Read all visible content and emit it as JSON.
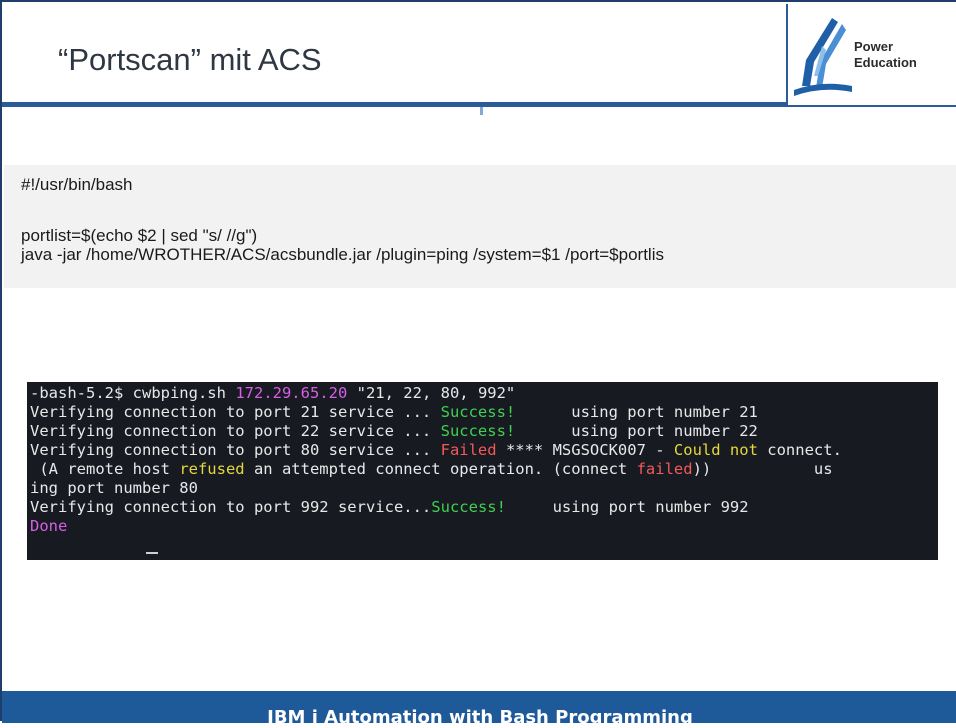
{
  "slide": {
    "title": "“Portscan” mit ACS",
    "logo": {
      "line1": "Power",
      "line2": "Education",
      "icon": "power-education-logo-icon"
    },
    "script": {
      "shebang": "#!/usr/bin/bash",
      "line_portlist": "portlist=$(echo $2 | sed \"s/ //g\")",
      "line_java": "java -jar /home/WROTHER/ACS/acsbundle.jar /plugin=ping /system=$1 /port=$portlis"
    },
    "terminal": {
      "prompt": "-bash-5.2$ cwbping.sh ",
      "ip": "172.29.65.20",
      "args": " \"21, 22, 80, 992\"",
      "l1_prefix": "Verifying connection to port 21 service ... ",
      "l1_status": "Success!",
      "l1_suffix": "      using port number 21",
      "l2_prefix": "Verifying connection to port 22 service ... ",
      "l2_status": "Success!",
      "l2_suffix": "      using port number 22",
      "l3_prefix": "Verifying connection to port 80 service ... ",
      "l3_status": "Failed",
      "l3_mid": " **** MSGSOCK007 - ",
      "l3_warn": "Could not",
      "l3_end": " connect.",
      "l4_a": " (A remote host ",
      "l4_refused": "refused",
      "l4_b": " an attempted connect operation. (connect ",
      "l4_failed": "failed",
      "l4_c": "))           us",
      "l5": "ing port number 80",
      "l6_prefix": "Verifying connection to port 992 service...",
      "l6_status": "Success!",
      "l6_suffix": "     using port number 992",
      "done": "Done"
    },
    "footer": "IBM i Automation with Bash Programming"
  }
}
